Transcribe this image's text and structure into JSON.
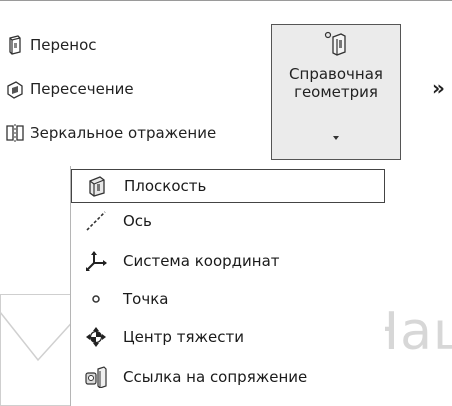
{
  "ribbon": {
    "commands": [
      {
        "label": "Перенос",
        "icon": "move-icon"
      },
      {
        "label": "Пересечение",
        "icon": "intersect-icon"
      },
      {
        "label": "Зеркальное отражение",
        "icon": "mirror-icon"
      }
    ],
    "ref_geometry": {
      "label": "Справочная геометрия",
      "icon": "reference-geometry-icon",
      "dropdown_arrow": "dropdown-arrow-icon"
    },
    "more_label": "»"
  },
  "menu": {
    "items": [
      {
        "label": "Плоскость",
        "icon": "plane-icon",
        "selected": true
      },
      {
        "label": "Ось",
        "icon": "axis-icon",
        "selected": false
      },
      {
        "label": "Система координат",
        "icon": "coordinate-system-icon",
        "selected": false
      },
      {
        "label": "Точка",
        "icon": "point-icon",
        "selected": false
      },
      {
        "label": "Центр тяжести",
        "icon": "center-of-mass-icon",
        "selected": false
      },
      {
        "label": "Ссылка на сопряжение",
        "icon": "mate-reference-icon",
        "selected": false
      }
    ]
  },
  "watermark": {
    "text": "Нац"
  },
  "colors": {
    "button_bg": "#ebebeb",
    "border": "#555555",
    "watermark": "#d7d7d7"
  }
}
